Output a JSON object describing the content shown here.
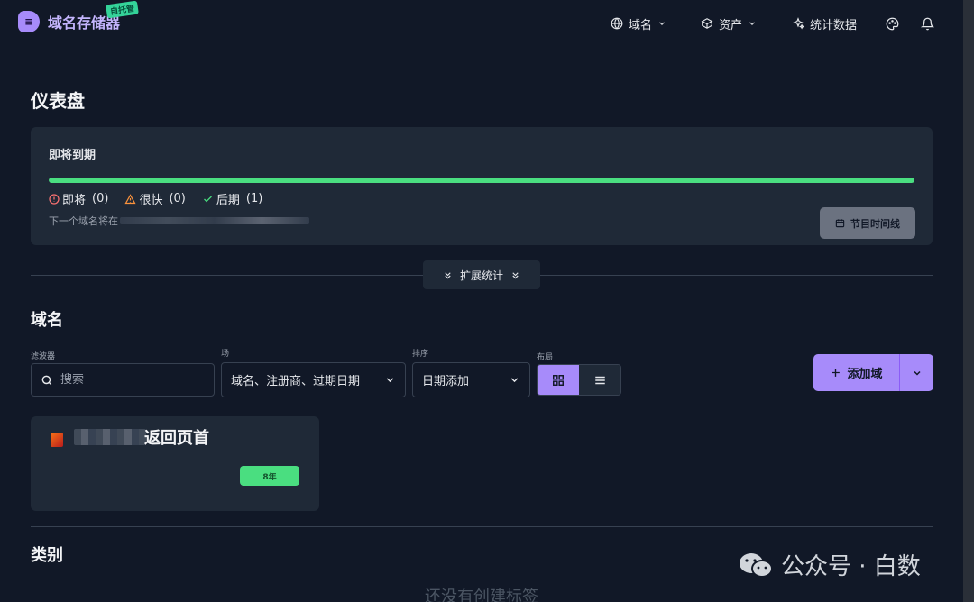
{
  "header": {
    "brand": "域名存储器",
    "brand_tag": "自托管",
    "nav": [
      {
        "label": "域名",
        "icon": "globe-icon",
        "has_dropdown": true
      },
      {
        "label": "资产",
        "icon": "box-icon",
        "has_dropdown": true
      },
      {
        "label": "统计数据",
        "icon": "sparkle-icon",
        "has_dropdown": false
      }
    ],
    "palette_icon": "palette-icon",
    "bell_icon": "bell-icon"
  },
  "dashboard": {
    "title": "仪表盘",
    "expiring": {
      "title": "即将到期",
      "progress_fraction": 1.0,
      "stats": {
        "soon_label": "即将",
        "soon_count": "(0)",
        "very_soon_label": "很快",
        "very_soon_count": "(0)",
        "later_label": "后期",
        "later_count": "(1)"
      },
      "next_text": "下一个域名将在",
      "timeline_button": "节目时间线"
    },
    "expand_stats": "扩展统计"
  },
  "domains": {
    "title": "域名",
    "filter_label": "滤波器",
    "search_placeholder": "搜索",
    "field_label": "场",
    "field_value": "域名、注册商、过期日期",
    "sort_label": "排序",
    "sort_value": "日期添加",
    "layout_label": "布局",
    "add_button": "添加域",
    "items": [
      {
        "name": "返回页首",
        "badge": "8年"
      }
    ]
  },
  "categories": {
    "title": "类别",
    "empty_text": "还没有创建标签"
  },
  "watermark": {
    "text": "公众号 · 白数"
  },
  "colors": {
    "background": "#111827",
    "panel": "#1f2937",
    "accent": "#a78bfa",
    "success": "#4ade80"
  }
}
